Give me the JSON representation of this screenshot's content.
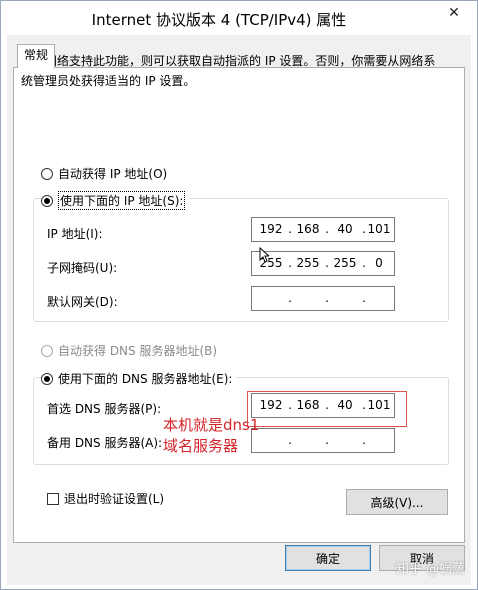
{
  "window": {
    "title": "Internet 协议版本 4 (TCP/IPv4) 属性",
    "close_glyph": "✕"
  },
  "tab": {
    "label": "常规"
  },
  "description": "如果网络支持此功能，则可以获取自动指派的 IP 设置。否则，你需要从网络系统管理员处获得适当的 IP 设置。",
  "ip_section": {
    "auto_label": "自动获得 IP 地址(O)",
    "manual_label": "使用下面的 IP 地址(S):",
    "selected": "manual",
    "ip_label": "IP 地址(I):",
    "ip_value": [
      "192",
      "168",
      "40",
      "101"
    ],
    "mask_label": "子网掩码(U):",
    "mask_value": [
      "255",
      "255",
      "255",
      "0"
    ],
    "gateway_label": "默认网关(D):",
    "gateway_value": [
      "",
      "",
      "",
      ""
    ]
  },
  "dns_section": {
    "auto_label": "自动获得 DNS 服务器地址(B)",
    "manual_label": "使用下面的 DNS 服务器地址(E):",
    "selected": "manual",
    "preferred_label": "首选 DNS 服务器(P):",
    "preferred_value": [
      "192",
      "168",
      "40",
      "101"
    ],
    "alternate_label": "备用 DNS 服务器(A):",
    "alternate_value": [
      "",
      "",
      "",
      ""
    ]
  },
  "annotation": {
    "line1": "本机就是dns1",
    "line2": "域名服务器",
    "color": "#d4242a"
  },
  "validate_label": "退出时验证设置(L)",
  "advanced_button": "高级(V)...",
  "ok_button": "确定",
  "cancel_button": "取消",
  "watermark": "知乎 @蜗蒸"
}
